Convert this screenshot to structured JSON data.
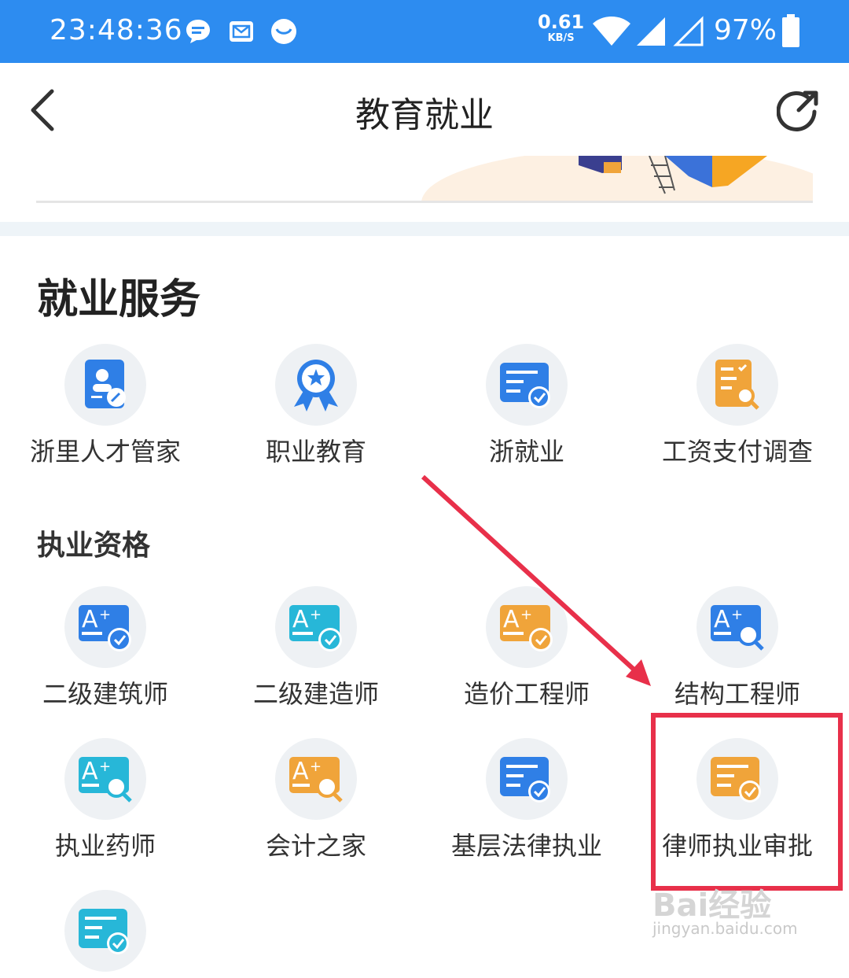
{
  "status_bar": {
    "time": "23:48:36",
    "net_speed_value": "0.61",
    "net_speed_unit": "KB/S",
    "battery": "97%",
    "icons": [
      "message-icon",
      "mail-icon",
      "bird-icon",
      "wifi-icon",
      "signal-icon",
      "signal-empty-icon",
      "battery-icon"
    ]
  },
  "nav": {
    "title": "教育就业",
    "back_icon": "back-arrow-icon",
    "share_icon": "share-icon"
  },
  "section": {
    "title": "就业服务",
    "subtitle": "执业资格"
  },
  "services": [
    {
      "label": "浙里人才管家",
      "icon": "person-card-icon",
      "color": "#2f7fe6"
    },
    {
      "label": "职业教育",
      "icon": "award-badge-icon",
      "color": "#2f7fe6"
    },
    {
      "label": "浙就业",
      "icon": "form-check-icon",
      "color": "#2f7fe6"
    },
    {
      "label": "工资支付调查",
      "icon": "doc-search-icon",
      "color": "#f0a43a"
    }
  ],
  "qualifications": [
    {
      "label": "二级建筑师",
      "icon": "grade-check-icon",
      "color": "#2f7fe6"
    },
    {
      "label": "二级建造师",
      "icon": "grade-check-icon",
      "color": "#27b7d8"
    },
    {
      "label": "造价工程师",
      "icon": "grade-check-icon",
      "color": "#f0a43a"
    },
    {
      "label": "结构工程师",
      "icon": "grade-search-icon",
      "color": "#2f7fe6"
    },
    {
      "label": "执业药师",
      "icon": "grade-search-icon",
      "color": "#27b7d8"
    },
    {
      "label": "会计之家",
      "icon": "grade-search-icon",
      "color": "#f0a43a"
    },
    {
      "label": "基层法律执业",
      "icon": "form-check-icon",
      "color": "#2f7fe6"
    },
    {
      "label": "律师执业审批",
      "icon": "form-check-icon",
      "color": "#f0a43a"
    },
    {
      "label": "",
      "icon": "form-check-icon",
      "color": "#27b7d8"
    }
  ],
  "watermark": {
    "main": "Bai经验",
    "sub": "jingyan.baidu.com"
  },
  "colors": {
    "status_bar": "#2d8cf0",
    "annotation": "#e8304a"
  }
}
